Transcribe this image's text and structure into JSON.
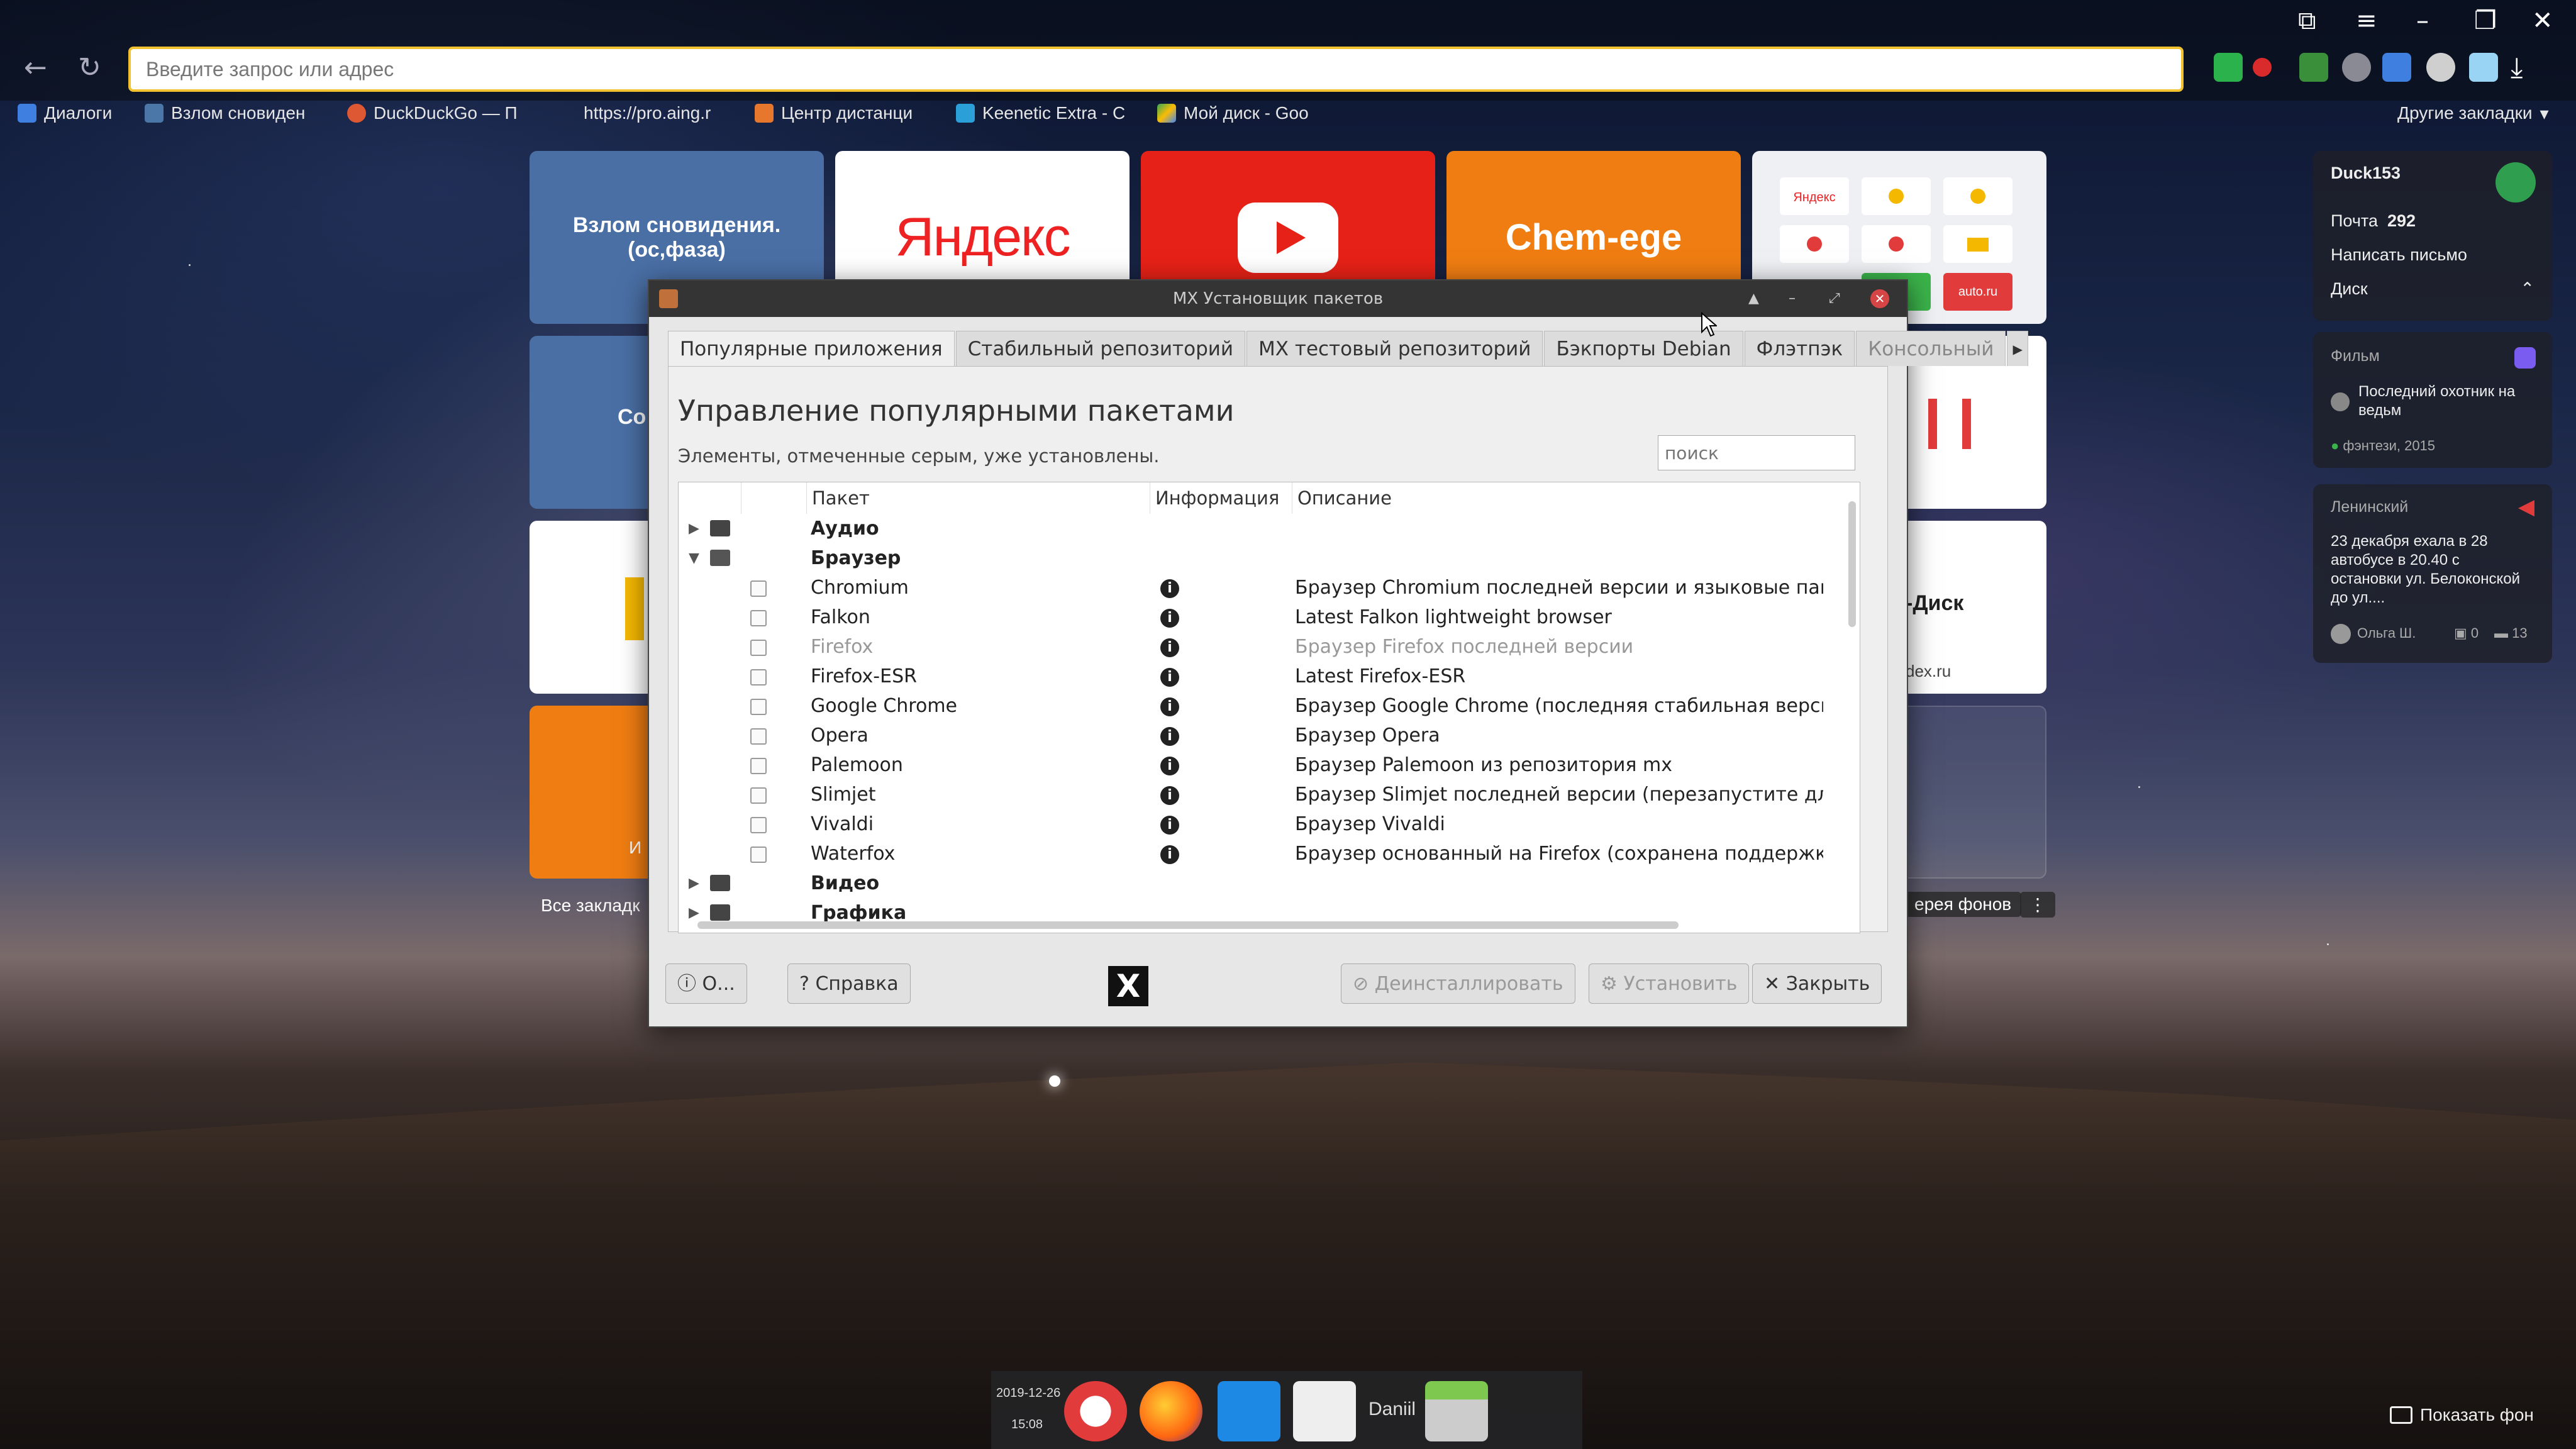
{
  "browser": {
    "address_placeholder": "Введите запрос или адрес",
    "other_bookmarks": "Другие закладки",
    "bookmarks": [
      {
        "label": "Диалоги"
      },
      {
        "label": "Взлом сновиден"
      },
      {
        "label": "DuckDuckGo — П"
      },
      {
        "label": "https://pro.aing.r"
      },
      {
        "label": "Центр дистанци"
      },
      {
        "label": "Keenetic Extra - C"
      },
      {
        "label": "Мой диск - Goo"
      }
    ]
  },
  "tiles": {
    "dream": "Взлом сновидения. (ос,фаза)",
    "yandex": "Яндекс",
    "chem": "Chem-ege",
    "all_bookmarks": "Все закладк",
    "disk_label": "-Диск",
    "disk_url": "dex.ru",
    "gallery": "ерея фонов",
    "partial_co": "Co",
    "partial_i": "И",
    "mini_auto": "auto.ru",
    "mini_yandex": "Яндекс"
  },
  "widgets": {
    "user": "Duck153",
    "mail_label": "Почта",
    "mail_count": "292",
    "write_mail": "Написать письмо",
    "disk": "Диск",
    "film_header": "Фильм",
    "film_title": "Последний охотник на ведьм",
    "film_meta": "фэнтези, 2015",
    "news_header": "Ленинский",
    "news_text": "23 декабря ехала в 28 автобусе в 20.40 с остановки ул. Белоконской до ул....",
    "news_author": "Ольга Ш.",
    "news_photos": "0",
    "news_comments": "13"
  },
  "dialog": {
    "title": "MX Установщик пакетов",
    "tabs": [
      "Популярные приложения",
      "Стабильный репозиторий",
      "MX тестовый репозиторий",
      "Бэкпорты Debian",
      "Флэтпэк",
      "Консольный"
    ],
    "heading": "Управление популярными пакетами",
    "subtitle": "Элементы, отмеченные серым, уже установлены.",
    "search_placeholder": "поиск",
    "columns": {
      "package": "Пакет",
      "info": "Информация",
      "description": "Описание"
    },
    "categories": {
      "audio": "Аудио",
      "browser": "Браузер",
      "video": "Видео",
      "graphics": "Графика"
    },
    "packages": [
      {
        "name": "Chromium",
        "desc": "Браузер Chromium последней версии и языковые пакеты"
      },
      {
        "name": "Falkon",
        "desc": "Latest Falkon lightweight browser"
      },
      {
        "name": "Firefox",
        "desc": "Браузер Firefox последней версии"
      },
      {
        "name": "Firefox-ESR",
        "desc": "Latest Firefox-ESR"
      },
      {
        "name": "Google Chrome",
        "desc": "Браузер Google Chrome (последняя стабильная версия)"
      },
      {
        "name": "Opera",
        "desc": "Браузер Opera"
      },
      {
        "name": "Palemoon",
        "desc": "Браузер Palemoon из репозитория mx"
      },
      {
        "name": "Slimjet",
        "desc": "Браузер Slimjet последней версии (перезапустите для устано"
      },
      {
        "name": "Vivaldi",
        "desc": "Браузер Vivaldi"
      },
      {
        "name": "Waterfox",
        "desc": "Браузер основанный на Firefox (сохранена поддержка допол"
      }
    ],
    "buttons": {
      "about": "О...",
      "help": "Справка",
      "uninstall": "Деинсталлировать",
      "install": "Установить",
      "close": "Закрыть"
    }
  },
  "taskbar": {
    "date": "2019-12-26",
    "time": "15:08",
    "user": "Daniil"
  },
  "show_background": "Показать фон",
  "colors": {
    "accent": "#f2c230",
    "youtube": "#e62117",
    "tile_blue": "#4a6fa5",
    "orange": "#ef7d12"
  }
}
